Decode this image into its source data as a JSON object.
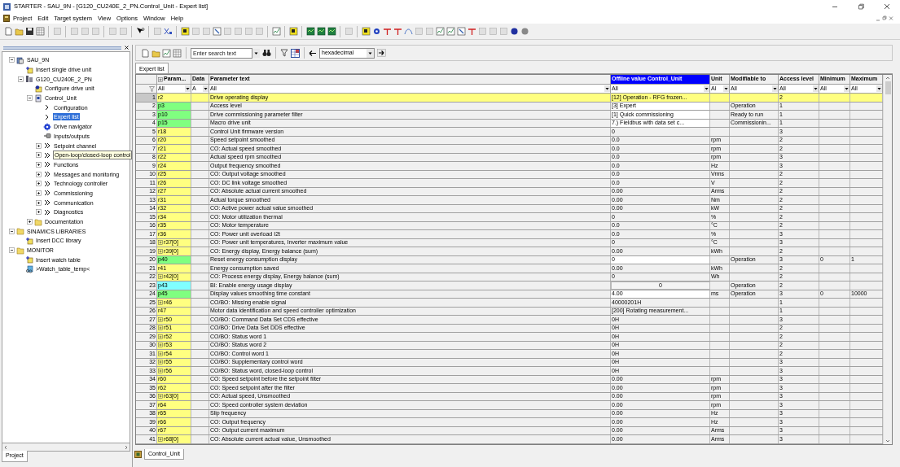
{
  "window": {
    "title": "STARTER - SAU_9N - [G120_CU240E_2_PN.Control_Unit - Expert list]"
  },
  "menu": [
    "Project",
    "Edit",
    "Target system",
    "View",
    "Options",
    "Window",
    "Help"
  ],
  "tree": [
    {
      "label": "SAU_9N",
      "kind": "project",
      "expanded": true,
      "selected": false,
      "hovered": false,
      "children": [
        {
          "label": "Insert single drive unit",
          "kind": "insert",
          "selected": false,
          "hovered": false
        },
        {
          "label": "G120_CU240E_2_PN",
          "kind": "drive",
          "expanded": true,
          "selected": false,
          "hovered": false,
          "children": [
            {
              "label": "Configure drive unit",
              "kind": "config",
              "selected": false,
              "hovered": false
            },
            {
              "label": "Control_Unit",
              "kind": "unit",
              "expanded": true,
              "selected": false,
              "hovered": false,
              "children": [
                {
                  "label": "Configuration",
                  "kind": "chevron",
                  "selected": false,
                  "hovered": false
                },
                {
                  "label": "Expert list",
                  "kind": "chevron",
                  "selected": true,
                  "hovered": false
                },
                {
                  "label": "Drive navigator",
                  "kind": "navigator",
                  "selected": false,
                  "hovered": false
                },
                {
                  "label": "Inputs/outputs",
                  "kind": "io",
                  "selected": false,
                  "hovered": false
                },
                {
                  "label": "Setpoint channel",
                  "kind": "double",
                  "expanded": false,
                  "selected": false,
                  "hovered": false
                },
                {
                  "label": "Open-loop/closed-loop control",
                  "kind": "double",
                  "expanded": false,
                  "selected": false,
                  "hovered": true
                },
                {
                  "label": "Functions",
                  "kind": "double",
                  "expanded": false,
                  "selected": false,
                  "hovered": false
                },
                {
                  "label": "Messages and monitoring",
                  "kind": "double",
                  "expanded": false,
                  "selected": false,
                  "hovered": false
                },
                {
                  "label": "Technology controller",
                  "kind": "double",
                  "expanded": false,
                  "selected": false,
                  "hovered": false
                },
                {
                  "label": "Commissioning",
                  "kind": "double",
                  "expanded": false,
                  "selected": false,
                  "hovered": false
                },
                {
                  "label": "Communication",
                  "kind": "double",
                  "expanded": false,
                  "selected": false,
                  "hovered": false
                },
                {
                  "label": "Diagnostics",
                  "kind": "double",
                  "expanded": false,
                  "selected": false,
                  "hovered": false
                }
              ]
            },
            {
              "label": "Documentation",
              "kind": "folder",
              "expanded": false,
              "selected": false,
              "hovered": false
            }
          ]
        }
      ]
    },
    {
      "label": "SINAMICS LIBRARIES",
      "kind": "folder",
      "expanded": true,
      "selected": false,
      "hovered": false,
      "children": [
        {
          "label": "Insert DCC library",
          "kind": "insert",
          "selected": false,
          "hovered": false
        }
      ]
    },
    {
      "label": "MONITOR",
      "kind": "folder",
      "expanded": true,
      "selected": false,
      "hovered": false,
      "children": [
        {
          "label": "Insert watch table",
          "kind": "insert",
          "selected": false,
          "hovered": false
        },
        {
          "label": ">Watch_table_temp<",
          "kind": "watch",
          "selected": false,
          "hovered": false
        }
      ]
    }
  ],
  "left_tab": "Project",
  "search": {
    "placeholder": "Enter search text",
    "number_format": "hexadecimal"
  },
  "tab": "Expert list",
  "columns": [
    {
      "label": "Param...",
      "filter": "All",
      "selected": false
    },
    {
      "label": "Data",
      "filter": "A",
      "selected": false
    },
    {
      "label": "Parameter text",
      "filter": "All",
      "selected": false
    },
    {
      "label": "Offline value Control_Unit",
      "filter": "All",
      "selected": true
    },
    {
      "label": "Unit",
      "filter": "Al",
      "selected": false
    },
    {
      "label": "Modifiable to",
      "filter": "All",
      "selected": false
    },
    {
      "label": "Access level",
      "filter": "All",
      "selected": false
    },
    {
      "label": "Minimum",
      "filter": "All",
      "selected": false
    },
    {
      "label": "Maximum",
      "filter": "All",
      "selected": false
    }
  ],
  "rows": [
    {
      "no": "1",
      "param": "r2",
      "expandable": false,
      "color": "#ffff80",
      "text": "Drive operating display",
      "value": "[12] Operation - RFG frozen...",
      "kind": "text",
      "access": "2",
      "selected": true
    },
    {
      "no": "2",
      "param": "p3",
      "expandable": false,
      "color": "#80ff80",
      "text": "Access level",
      "value": "[3] Expert",
      "kind": "field",
      "modifiable": "Operation",
      "access": "1",
      "selected": false
    },
    {
      "no": "3",
      "param": "p10",
      "expandable": false,
      "color": "#80ff80",
      "text": "Drive commissioning parameter filter",
      "value": "[1] Quick commissioning",
      "kind": "field",
      "modifiable": "Ready to run",
      "access": "1",
      "selected": false
    },
    {
      "no": "4",
      "param": "p15",
      "expandable": false,
      "color": "#80ff80",
      "text": "Macro drive unit",
      "value": "7.) Fieldbus with data set c...",
      "kind": "field",
      "modifiable": "Commissionin...",
      "access": "1",
      "selected": false
    },
    {
      "no": "5",
      "param": "r18",
      "expandable": false,
      "color": "#ffff80",
      "text": "Control Unit firmware version",
      "value": "0",
      "kind": "text",
      "access": "3",
      "selected": false
    },
    {
      "no": "6",
      "param": "r20",
      "expandable": false,
      "color": "#ffff80",
      "text": "Speed setpoint smoothed",
      "value": "0.0",
      "kind": "text",
      "unit": "rpm",
      "access": "2",
      "selected": false
    },
    {
      "no": "7",
      "param": "r21",
      "expandable": false,
      "color": "#ffff80",
      "text": "CO: Actual speed smoothed",
      "value": "0.0",
      "kind": "text",
      "unit": "rpm",
      "access": "2",
      "selected": false
    },
    {
      "no": "8",
      "param": "r22",
      "expandable": false,
      "color": "#ffff80",
      "text": "Actual speed rpm smoothed",
      "value": "0.0",
      "kind": "text",
      "unit": "rpm",
      "access": "3",
      "selected": false
    },
    {
      "no": "9",
      "param": "r24",
      "expandable": false,
      "color": "#ffff80",
      "text": "Output frequency smoothed",
      "value": "0.0",
      "kind": "text",
      "unit": "Hz",
      "access": "3",
      "selected": false
    },
    {
      "no": "10",
      "param": "r25",
      "expandable": false,
      "color": "#ffff80",
      "text": "CO: Output voltage smoothed",
      "value": "0.0",
      "kind": "text",
      "unit": "Vrms",
      "access": "2",
      "selected": false
    },
    {
      "no": "11",
      "param": "r26",
      "expandable": false,
      "color": "#ffff80",
      "text": "CO: DC link voltage smoothed",
      "value": "0.0",
      "kind": "text",
      "unit": "V",
      "access": "2",
      "selected": false
    },
    {
      "no": "12",
      "param": "r27",
      "expandable": false,
      "color": "#ffff80",
      "text": "CO: Absolute actual current smoothed",
      "value": "0.00",
      "kind": "text",
      "unit": "Arms",
      "access": "2",
      "selected": false
    },
    {
      "no": "13",
      "param": "r31",
      "expandable": false,
      "color": "#ffff80",
      "text": "Actual torque smoothed",
      "value": "0.00",
      "kind": "text",
      "unit": "Nm",
      "access": "2",
      "selected": false
    },
    {
      "no": "14",
      "param": "r32",
      "expandable": false,
      "color": "#ffff80",
      "text": "CO: Active power actual value smoothed",
      "value": "0.00",
      "kind": "text",
      "unit": "kW",
      "access": "2",
      "selected": false
    },
    {
      "no": "15",
      "param": "r34",
      "expandable": false,
      "color": "#ffff80",
      "text": "CO: Motor utilization thermal",
      "value": "0",
      "kind": "text",
      "unit": "%",
      "access": "2",
      "selected": false
    },
    {
      "no": "16",
      "param": "r35",
      "expandable": false,
      "color": "#ffff80",
      "text": "CO: Motor temperature",
      "value": "0.0",
      "kind": "text",
      "unit": "°C",
      "access": "2",
      "selected": false
    },
    {
      "no": "17",
      "param": "r36",
      "expandable": false,
      "color": "#ffff80",
      "text": "CO: Power unit overload I2t",
      "value": "0.0",
      "kind": "text",
      "unit": "%",
      "access": "3",
      "selected": false
    },
    {
      "no": "18",
      "param": "r37[0]",
      "expandable": true,
      "color": "#ffff80",
      "text": "CO: Power unit temperatures, Inverter maximum value",
      "value": "0",
      "kind": "text",
      "unit": "°C",
      "access": "3",
      "selected": false
    },
    {
      "no": "19",
      "param": "r39[0]",
      "expandable": true,
      "color": "#ffff80",
      "text": "CO: Energy display, Energy balance (sum)",
      "value": "0.00",
      "kind": "text",
      "unit": "kWh",
      "access": "2",
      "selected": false
    },
    {
      "no": "20",
      "param": "p40",
      "expandable": false,
      "color": "#80ff80",
      "text": "Reset energy consumption display",
      "value": "0",
      "kind": "field",
      "modifiable": "Operation",
      "access": "3",
      "minimum": "0",
      "maximum": "1",
      "selected": false
    },
    {
      "no": "21",
      "param": "r41",
      "expandable": false,
      "color": "#ffff80",
      "text": "Energy consumption saved",
      "value": "0.00",
      "kind": "text",
      "unit": "kWh",
      "access": "2",
      "selected": false
    },
    {
      "no": "22",
      "param": "r42[0]",
      "expandable": true,
      "color": "#ffff80",
      "text": "CO: Process energy display, Energy balance (sum)",
      "value": "0",
      "kind": "text",
      "unit": "Wh",
      "access": "2",
      "selected": false
    },
    {
      "no": "23",
      "param": "p43",
      "expandable": false,
      "color": "#80ffff",
      "text": "BI: Enable energy usage display",
      "value": "0",
      "kind": "button",
      "modifiable": "Operation",
      "access": "2",
      "selected": false
    },
    {
      "no": "24",
      "param": "p45",
      "expandable": false,
      "color": "#80ff80",
      "text": "Display values smoothing time constant",
      "value": "4.00",
      "kind": "field",
      "unit": "ms",
      "modifiable": "Operation",
      "access": "3",
      "minimum": "0",
      "maximum": "10000",
      "selected": false
    },
    {
      "no": "25",
      "param": "r46",
      "expandable": true,
      "color": "#ffff80",
      "text": "CO/BO: Missing enable signal",
      "value": "40000201H",
      "kind": "text",
      "access": "1",
      "selected": false
    },
    {
      "no": "26",
      "param": "r47",
      "expandable": false,
      "color": "#ffff80",
      "text": "Motor data identification and speed controller optimization",
      "value": "[200] Rotating measurement...",
      "kind": "text",
      "access": "1",
      "selected": false
    },
    {
      "no": "27",
      "param": "r50",
      "expandable": true,
      "color": "#ffff80",
      "text": "CO/BO: Command Data Set CDS effective",
      "value": "0H",
      "kind": "text",
      "access": "3",
      "selected": false
    },
    {
      "no": "28",
      "param": "r51",
      "expandable": true,
      "color": "#ffff80",
      "text": "CO/BO: Drive Data Set DDS effective",
      "value": "0H",
      "kind": "text",
      "access": "2",
      "selected": false
    },
    {
      "no": "29",
      "param": "r52",
      "expandable": true,
      "color": "#ffff80",
      "text": "CO/BO: Status word 1",
      "value": "0H",
      "kind": "text",
      "access": "2",
      "selected": false
    },
    {
      "no": "30",
      "param": "r53",
      "expandable": true,
      "color": "#ffff80",
      "text": "CO/BO: Status word 2",
      "value": "0H",
      "kind": "text",
      "access": "2",
      "selected": false
    },
    {
      "no": "31",
      "param": "r54",
      "expandable": true,
      "color": "#ffff80",
      "text": "CO/BO: Control word 1",
      "value": "0H",
      "kind": "text",
      "access": "2",
      "selected": false
    },
    {
      "no": "32",
      "param": "r55",
      "expandable": true,
      "color": "#ffff80",
      "text": "CO/BO: Supplementary control word",
      "value": "0H",
      "kind": "text",
      "access": "3",
      "selected": false
    },
    {
      "no": "33",
      "param": "r56",
      "expandable": true,
      "color": "#ffff80",
      "text": "CO/BO: Status word, closed-loop control",
      "value": "0H",
      "kind": "text",
      "access": "3",
      "selected": false
    },
    {
      "no": "34",
      "param": "r60",
      "expandable": false,
      "color": "#ffff80",
      "text": "CO: Speed setpoint before the setpoint filter",
      "value": "0.00",
      "kind": "text",
      "unit": "rpm",
      "access": "3",
      "selected": false
    },
    {
      "no": "35",
      "param": "r62",
      "expandable": false,
      "color": "#ffff80",
      "text": "CO: Speed setpoint after the filter",
      "value": "0.00",
      "kind": "text",
      "unit": "rpm",
      "access": "3",
      "selected": false
    },
    {
      "no": "36",
      "param": "r63[0]",
      "expandable": true,
      "color": "#ffff80",
      "text": "CO: Actual speed, Unsmoothed",
      "value": "0.00",
      "kind": "text",
      "unit": "rpm",
      "access": "3",
      "selected": false
    },
    {
      "no": "37",
      "param": "r64",
      "expandable": false,
      "color": "#ffff80",
      "text": "CO: Speed controller system deviation",
      "value": "0.00",
      "kind": "text",
      "unit": "rpm",
      "access": "3",
      "selected": false
    },
    {
      "no": "38",
      "param": "r65",
      "expandable": false,
      "color": "#ffff80",
      "text": "Slip frequency",
      "value": "0.00",
      "kind": "text",
      "unit": "Hz",
      "access": "3",
      "selected": false
    },
    {
      "no": "39",
      "param": "r66",
      "expandable": false,
      "color": "#ffff80",
      "text": "CO: Output frequency",
      "value": "0.00",
      "kind": "text",
      "unit": "Hz",
      "access": "3",
      "selected": false
    },
    {
      "no": "40",
      "param": "r67",
      "expandable": false,
      "color": "#ffff80",
      "text": "CO: Output current maximum",
      "value": "0.00",
      "kind": "text",
      "unit": "Arms",
      "access": "3",
      "selected": false
    },
    {
      "no": "41",
      "param": "r68[0]",
      "expandable": true,
      "color": "#ffff80",
      "text": "CO: Absolute current actual value, Unsmoothed",
      "value": "0.00",
      "kind": "text",
      "unit": "Arms",
      "access": "3",
      "selected": false
    }
  ],
  "bottom_tab": "Control_Unit"
}
